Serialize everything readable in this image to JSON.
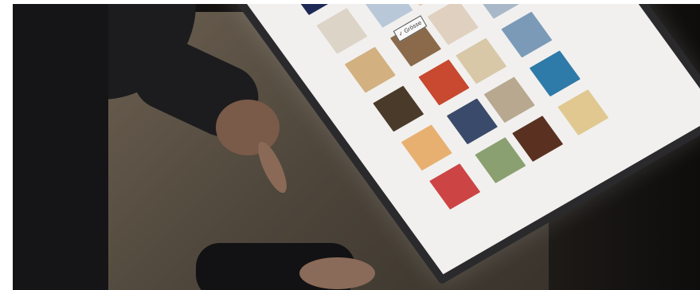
{
  "scene": {
    "description_free": true,
    "kiosk": {
      "sort_button_label": "✓ Grösse",
      "tiles": [
        {
          "color": "#1e2a55"
        },
        {
          "color": "#e8e0d8"
        },
        {
          "color": "#c9b08a"
        },
        {
          "color": "#6a4a2a"
        },
        {
          "color": "#ddd4c8"
        },
        {
          "color": "#b8c8d8"
        },
        {
          "color": "#f0c8b8"
        },
        {
          "color": "#5a7a4a"
        },
        {
          "color": "#d2b080"
        },
        {
          "color": "#8a6a4a"
        },
        {
          "color": "#e0d0c0"
        },
        {
          "color": "#a8b8c8"
        },
        {
          "color": "#4a3a2a"
        },
        {
          "color": "#c84830"
        },
        {
          "color": "#d8c8a8"
        },
        {
          "color": "#7a9ab8"
        },
        {
          "color": "#e8b070"
        },
        {
          "color": "#3a4a6a"
        },
        {
          "color": "#b8a890"
        },
        {
          "color": "#2e7aa8"
        },
        {
          "color": "#cc4444"
        },
        {
          "color": "#8aa070"
        },
        {
          "color": "#5a3020"
        },
        {
          "color": "#e0c890"
        }
      ]
    }
  }
}
